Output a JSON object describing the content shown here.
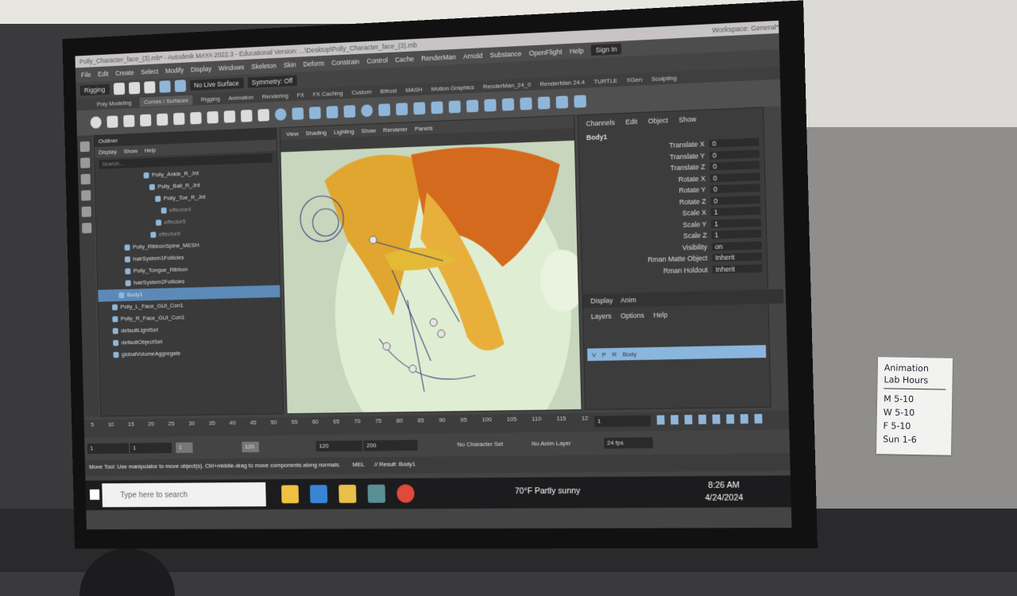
{
  "maya": {
    "title": "Polly_Character_face_(3).mb* - Autodesk MAYA 2022.3 - Educational Version: ...\\Desktop\\Polly_Character_face_(3).mb",
    "workspace_label": "Workspace:",
    "workspace_value": "General*",
    "sign_in": "Sign In",
    "menu": [
      "File",
      "Edit",
      "Create",
      "Select",
      "Modify",
      "Display",
      "Windows",
      "Skeleton",
      "Skin",
      "Deform",
      "Constrain",
      "Control",
      "Cache",
      "RenderMan",
      "Arnold",
      "Substance",
      "OpenFlight",
      "Help"
    ],
    "mode": "Rigging",
    "status": {
      "surface": "No Live Surface",
      "symmetry": "Symmetry: Off"
    },
    "shelf_tabs": [
      "Poly Modeling",
      "Curves / Surfaces",
      "Rigging",
      "Animation",
      "Rendering",
      "FX",
      "FX Caching",
      "Custom",
      "Bifrost",
      "MASH",
      "Motion Graphics",
      "RenderMan_24_0",
      "RenderMan 24.4",
      "TURTLE",
      "XGen",
      "Sculpting"
    ],
    "outliner": {
      "title": "Outliner",
      "menu": [
        "Display",
        "Show",
        "Help"
      ],
      "search_placeholder": "Search...",
      "items": [
        "Polly_Ankle_R_Jnt",
        "Polly_Ball_R_Jnt",
        "Polly_Toe_R_Jnt",
        "effector4",
        "effector5",
        "effector6",
        "Polly_RibbonSpine_MESH",
        "hairSystem1Follicles",
        "Polly_Tongue_Ribbon",
        "hairSystem2Follicles",
        "Body1",
        "Polly_L_Face_GUI_Con1",
        "Polly_R_Face_GUI_Con1",
        "defaultLightSet",
        "defaultObjectSet",
        "globalVolumeAggregate"
      ]
    },
    "viewport_menu": [
      "View",
      "Shading",
      "Lighting",
      "Show",
      "Renderer",
      "Panels"
    ],
    "channel_box": {
      "menu": [
        "Channels",
        "Edit",
        "Object",
        "Show"
      ],
      "object": "Body1",
      "attrs": [
        {
          "name": "Translate X",
          "value": "0"
        },
        {
          "name": "Translate Y",
          "value": "0"
        },
        {
          "name": "Translate Z",
          "value": "0"
        },
        {
          "name": "Rotate X",
          "value": "0"
        },
        {
          "name": "Rotate Y",
          "value": "0"
        },
        {
          "name": "Rotate Z",
          "value": "0"
        },
        {
          "name": "Scale X",
          "value": "1"
        },
        {
          "name": "Scale Y",
          "value": "1"
        },
        {
          "name": "Scale Z",
          "value": "1"
        },
        {
          "name": "Visibility",
          "value": "on"
        },
        {
          "name": "Rman Matte Object",
          "value": "Inherit"
        },
        {
          "name": "Rman Holdout",
          "value": "Inherit"
        }
      ],
      "layer_tabs": [
        "Display",
        "Anim"
      ],
      "layer_menu": [
        "Layers",
        "Options",
        "Help"
      ],
      "layer_row": {
        "v": "V",
        "p": "P",
        "r": "R",
        "name": "Body"
      }
    },
    "timeline": {
      "ticks": [
        "5",
        "10",
        "15",
        "20",
        "25",
        "30",
        "35",
        "40",
        "45",
        "50",
        "55",
        "60",
        "65",
        "70",
        "75",
        "80",
        "85",
        "90",
        "95",
        "100",
        "105",
        "110",
        "115",
        "12"
      ],
      "current_frame": "1"
    },
    "range": {
      "start": "1",
      "start2": "1",
      "slider_start": "1",
      "slider_end": "120",
      "end": "120",
      "end2": "200",
      "character_set": "No Character Set",
      "anim_layer": "No Anim Layer",
      "fps": "24 fps"
    },
    "help_line": "Move Tool: Use manipulator to move object(s). Ctrl+middle-drag to move components along normals. Shift+drag",
    "mel_label": "MEL",
    "result": "// Result: Body1"
  },
  "taskbar": {
    "search_placeholder": "Type here to search",
    "weather": "70°F  Partly sunny",
    "time": "8:26 AM",
    "date": "4/24/2024"
  },
  "sign": {
    "title1": "Animation",
    "title2": "Lab Hours",
    "lines": [
      "M   5-10",
      "W   5-10",
      "F   5-10",
      "Sun  1-6"
    ]
  }
}
